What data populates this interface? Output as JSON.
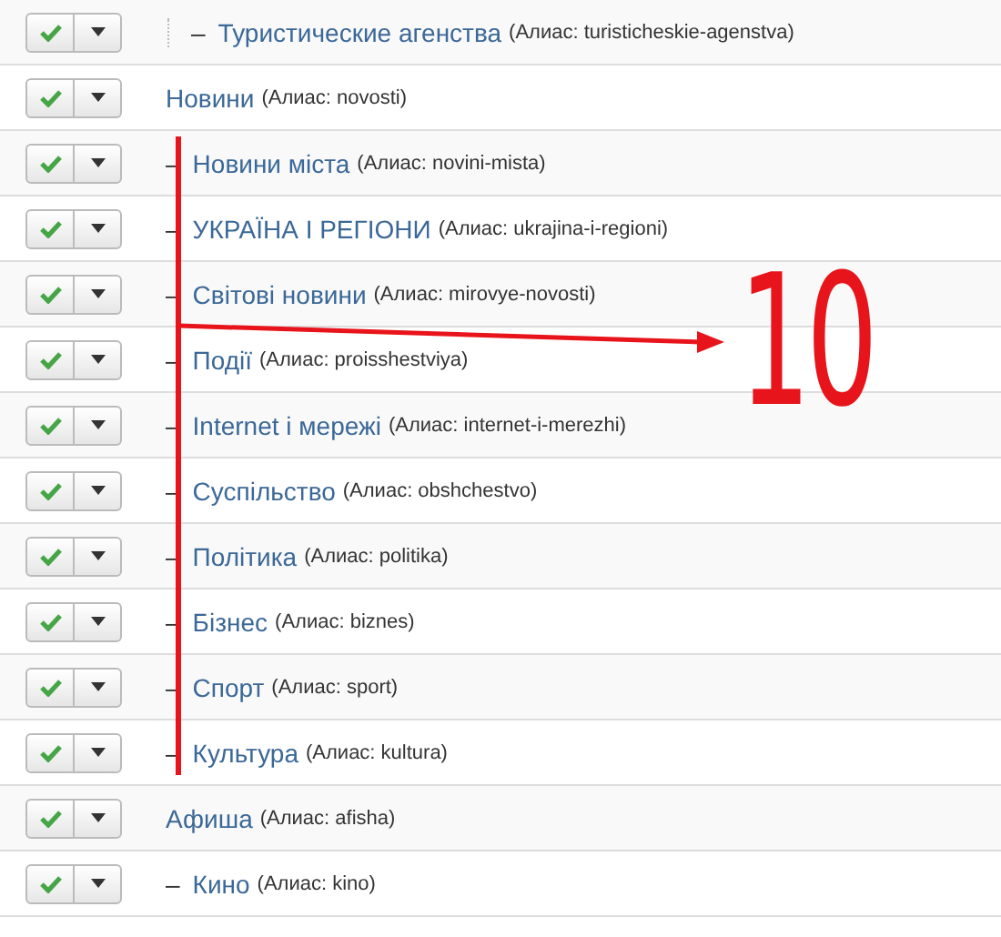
{
  "categories": [
    {
      "kind": "nested",
      "prefix": "–",
      "title": "Туристические агенства",
      "alias": "(Алиас: turisticheskie-agenstva)",
      "published": true
    },
    {
      "kind": "root",
      "title": "Новини",
      "alias": "(Алиас: novosti)",
      "published": true,
      "children": [
        {
          "prefix": "–",
          "title": "Новини міста",
          "alias": "(Алиас: novini-mista)",
          "published": true
        },
        {
          "prefix": "–",
          "title": "УКРАЇНА І РЕГІОНИ",
          "alias": "(Алиас: ukrajina-i-regioni)",
          "published": true
        },
        {
          "prefix": "–",
          "title": "Світові новини",
          "alias": "(Алиас: mirovye-novosti)",
          "published": true
        },
        {
          "prefix": "–",
          "title": "Події",
          "alias": "(Алиас: proisshestviya)",
          "published": true
        },
        {
          "prefix": "–",
          "title": "Internet і мережі",
          "alias": "(Алиас: internet-i-merezhi)",
          "published": true
        },
        {
          "prefix": "–",
          "title": "Суспільство",
          "alias": "(Алиас: obshchestvo)",
          "published": true
        },
        {
          "prefix": "–",
          "title": "Політика",
          "alias": "(Алиас: politika)",
          "published": true
        },
        {
          "prefix": "–",
          "title": "Бізнес",
          "alias": "(Алиас: biznes)",
          "published": true
        },
        {
          "prefix": "–",
          "title": "Спорт",
          "alias": "(Алиас: sport)",
          "published": true
        },
        {
          "prefix": "–",
          "title": "Культура",
          "alias": "(Алиас: kultura)",
          "published": true
        }
      ]
    },
    {
      "kind": "root",
      "title": "Афиша",
      "alias": "(Алиас: afisha)",
      "published": true,
      "children": [
        {
          "prefix": "–",
          "title": "Кино",
          "alias": "(Алиас: kino)",
          "published": true
        }
      ]
    }
  ],
  "annotation": {
    "text": "10"
  }
}
